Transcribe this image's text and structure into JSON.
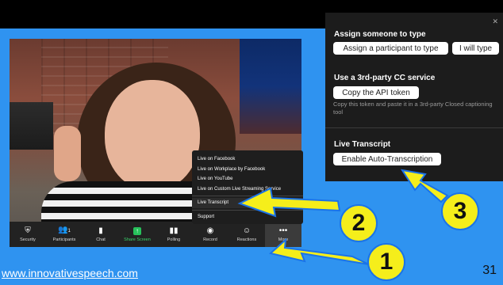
{
  "zoom_toolbar": {
    "items": [
      {
        "label": "Security",
        "icon": "shield-icon"
      },
      {
        "label": "Participants",
        "icon": "participants-icon",
        "count": "1"
      },
      {
        "label": "Chat",
        "icon": "chat-icon"
      },
      {
        "label": "Share Screen",
        "icon": "share-screen-icon"
      },
      {
        "label": "Polling",
        "icon": "polling-icon"
      },
      {
        "label": "Record",
        "icon": "record-icon"
      },
      {
        "label": "Reactions",
        "icon": "reactions-icon"
      },
      {
        "label": "More",
        "icon": "more-icon"
      }
    ]
  },
  "more_menu": {
    "items": [
      "Live on Facebook",
      "Live on Workplace by Facebook",
      "Live on YouTube",
      "Live on Custom Live Streaming Service",
      "Live Transcript",
      "Support"
    ]
  },
  "cc_panel": {
    "assign_heading": "Assign someone to type",
    "assign_button": "Assign a participant to type",
    "i_will_type_button": "I will type",
    "third_party_heading": "Use a 3rd-party CC service",
    "copy_api_button": "Copy the API token",
    "copy_description": "Copy this token and paste it in a 3rd-party Closed captioning tool",
    "live_transcript_heading": "Live Transcript",
    "enable_button": "Enable Auto-Transcription"
  },
  "annotations": {
    "badge_1": "1",
    "badge_2": "2",
    "badge_3": "3"
  },
  "footer": {
    "site_link": "www.innovativespeech.com",
    "page_number": "31"
  },
  "colors": {
    "background": "#2f93f0",
    "arrow": "#f5ee1b",
    "arrow_outline": "#1a73e8"
  }
}
